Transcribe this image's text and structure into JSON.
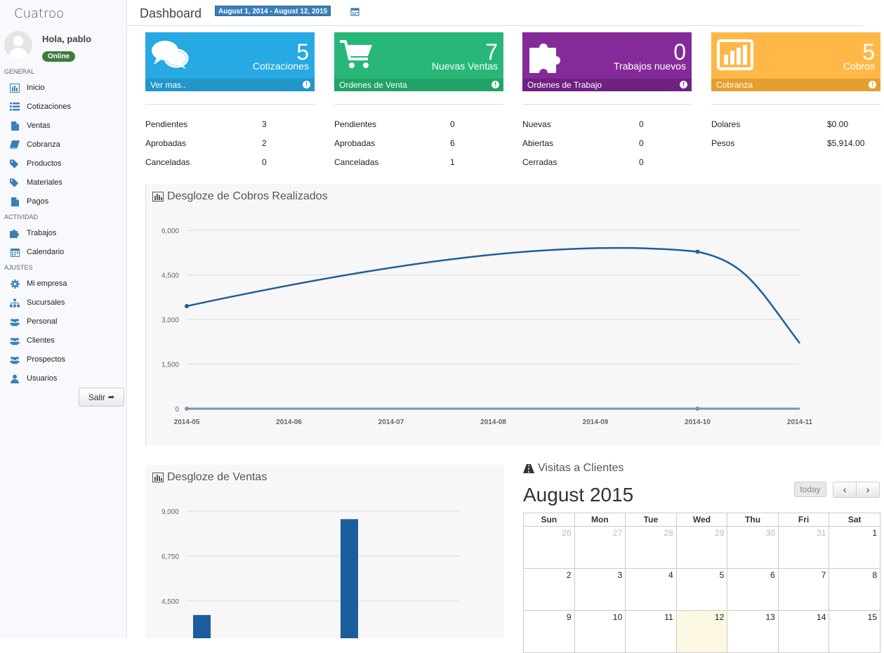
{
  "brand": "Cuatroo",
  "user": {
    "greeting": "Hola, pablo",
    "status": "Online"
  },
  "sidebar": {
    "sections": [
      "GENERAL",
      "ACTIVIDAD",
      "AJUSTES"
    ],
    "general": [
      {
        "label": "Inicio",
        "icon": "bar-chart-icon"
      },
      {
        "label": "Cotizaciones",
        "icon": "list-icon"
      },
      {
        "label": "Ventas",
        "icon": "file-icon"
      },
      {
        "label": "Cobranza",
        "icon": "book-icon"
      },
      {
        "label": "Productos",
        "icon": "tags-icon"
      },
      {
        "label": "Materiales",
        "icon": "tags-icon"
      },
      {
        "label": "Pagos",
        "icon": "file-icon"
      }
    ],
    "actividad": [
      {
        "label": "Trabajos",
        "icon": "puzzle-icon"
      },
      {
        "label": "Calendario",
        "icon": "calendar-icon"
      }
    ],
    "ajustes": [
      {
        "label": "Mi empresa",
        "icon": "gear-icon"
      },
      {
        "label": "Sucursales",
        "icon": "sitemap-icon"
      },
      {
        "label": "Personal",
        "icon": "group-icon"
      },
      {
        "label": "Clientes",
        "icon": "group-icon"
      },
      {
        "label": "Prospectos",
        "icon": "group-icon"
      },
      {
        "label": "Usuarios",
        "icon": "user-icon"
      }
    ],
    "logout": "Salir"
  },
  "header": {
    "title": "Dashboard",
    "date_range": "August 1, 2014 - August 12, 2015"
  },
  "tiles": [
    {
      "count": "5",
      "label": "Cotizaciones",
      "footer": "Ver mas..",
      "color": "#27a9e3",
      "footer_color": "#2295c9",
      "icon": "comments-icon"
    },
    {
      "count": "7",
      "label": "Nuevas Ventas",
      "footer": "Ordenes de Venta",
      "color": "#28b779",
      "footer_color": "#21a268",
      "icon": "cart-icon"
    },
    {
      "count": "0",
      "label": "Trabajos nuevos",
      "footer": "Ordenes de Trabajo",
      "color": "#852b99",
      "footer_color": "#6e2180",
      "icon": "puzzle-icon"
    },
    {
      "count": "5",
      "label": "Cobros",
      "footer": "Cobranza",
      "color": "#ffb848",
      "footer_color": "#e59f2f",
      "icon": "bar-chart-icon"
    }
  ],
  "stats": [
    [
      {
        "label": "Pendientes",
        "value": "3"
      },
      {
        "label": "Aprobadas",
        "value": "2"
      },
      {
        "label": "Canceladas",
        "value": "0"
      }
    ],
    [
      {
        "label": "Pendientes",
        "value": "0"
      },
      {
        "label": "Aprobadas",
        "value": "6"
      },
      {
        "label": "Canceladas",
        "value": "1"
      }
    ],
    [
      {
        "label": "Nuevas",
        "value": "0"
      },
      {
        "label": "Abiertas",
        "value": "0"
      },
      {
        "label": "Cerradas",
        "value": "0"
      }
    ],
    [
      {
        "label": "Dolares",
        "value": "$0.00"
      },
      {
        "label": "Pesos",
        "value": "$5,914.00"
      }
    ]
  ],
  "panels": {
    "cobros_title": "Desgloze de Cobros Realizados",
    "ventas_title": "Desgloze de Ventas",
    "visitas_title": "Visitas a Clientes"
  },
  "chart_data": [
    {
      "type": "line",
      "title": "Desgloze de Cobros Realizados",
      "x": [
        "2014-05",
        "2014-06",
        "2014-07",
        "2014-08",
        "2014-09",
        "2014-10",
        "2014-11"
      ],
      "ylim": [
        0,
        6000
      ],
      "yticks": [
        "6,000",
        "4,500",
        "3,000",
        "1,500",
        "0"
      ],
      "grid": true,
      "series": [
        {
          "color": "#1f5f99",
          "points": [
            {
              "x": "2014-05",
              "y": 3450
            },
            {
              "x": "2014-10",
              "y": 5280
            },
            {
              "x": "2014-11",
              "y": 2200
            }
          ]
        },
        {
          "color": "#7f94a8",
          "points": [
            {
              "x": "2014-05",
              "y": 0
            },
            {
              "x": "2014-10",
              "y": 0
            },
            {
              "x": "2014-11",
              "y": 0
            }
          ]
        }
      ]
    },
    {
      "type": "bar",
      "title": "Desgloze de Ventas",
      "ylim": [
        0,
        9000
      ],
      "yticks": [
        "9,000",
        "6,750",
        "4,500"
      ],
      "grid": true,
      "values": [
        3800,
        8600
      ],
      "color": "#1a5e9e"
    }
  ],
  "calendar": {
    "title": "August 2015",
    "today_label": "today",
    "prev": "‹",
    "next": "›",
    "weekdays": [
      "Sun",
      "Mon",
      "Tue",
      "Wed",
      "Thu",
      "Fri",
      "Sat"
    ],
    "weeks": [
      [
        {
          "d": "26",
          "other": true
        },
        {
          "d": "27",
          "other": true
        },
        {
          "d": "28",
          "other": true
        },
        {
          "d": "29",
          "other": true
        },
        {
          "d": "30",
          "other": true
        },
        {
          "d": "31",
          "other": true
        },
        {
          "d": "1"
        }
      ],
      [
        {
          "d": "2"
        },
        {
          "d": "3"
        },
        {
          "d": "4"
        },
        {
          "d": "5"
        },
        {
          "d": "6"
        },
        {
          "d": "7"
        },
        {
          "d": "8"
        }
      ],
      [
        {
          "d": "9"
        },
        {
          "d": "10"
        },
        {
          "d": "11"
        },
        {
          "d": "12",
          "today": true
        },
        {
          "d": "13"
        },
        {
          "d": "14"
        },
        {
          "d": "15"
        }
      ]
    ]
  }
}
